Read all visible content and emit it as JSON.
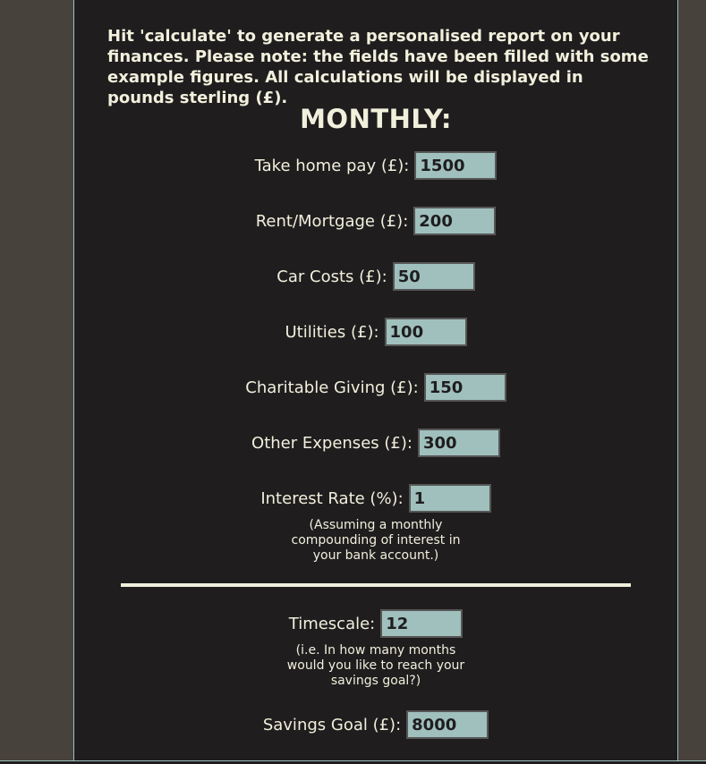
{
  "intro": {
    "text": "Hit 'calculate' to generate a personalised report on your finances. Please note: the fields have been filled with some example figures. All calculations will be displayed in pounds sterling (£)."
  },
  "heading": "MONTHLY:",
  "fields": {
    "take_home_pay": {
      "label": "Take home pay (£):",
      "value": "1500"
    },
    "rent": {
      "label": "Rent/Mortgage (£):",
      "value": "200"
    },
    "car": {
      "label": "Car Costs (£):",
      "value": "50"
    },
    "utilities": {
      "label": "Utilities (£):",
      "value": "100"
    },
    "charity": {
      "label": "Charitable Giving (£):",
      "value": "150"
    },
    "other": {
      "label": "Other Expenses (£):",
      "value": "300"
    },
    "interest": {
      "label": "Interest Rate (%):",
      "value": "1"
    },
    "timescale": {
      "label": "Timescale:",
      "value": "12"
    },
    "goal": {
      "label": "Savings Goal (£):",
      "value": "8000"
    }
  },
  "notes": {
    "interest": "(Assuming a monthly compounding of interest in your bank account.)",
    "timescale": "(i.e. In how many months would you like to reach your savings goal?)"
  },
  "colors": {
    "panel_bg": "#1f1d1e",
    "outer_bg": "#48423d",
    "input_bg": "#9fc0bd",
    "text": "#f1f0dc"
  }
}
